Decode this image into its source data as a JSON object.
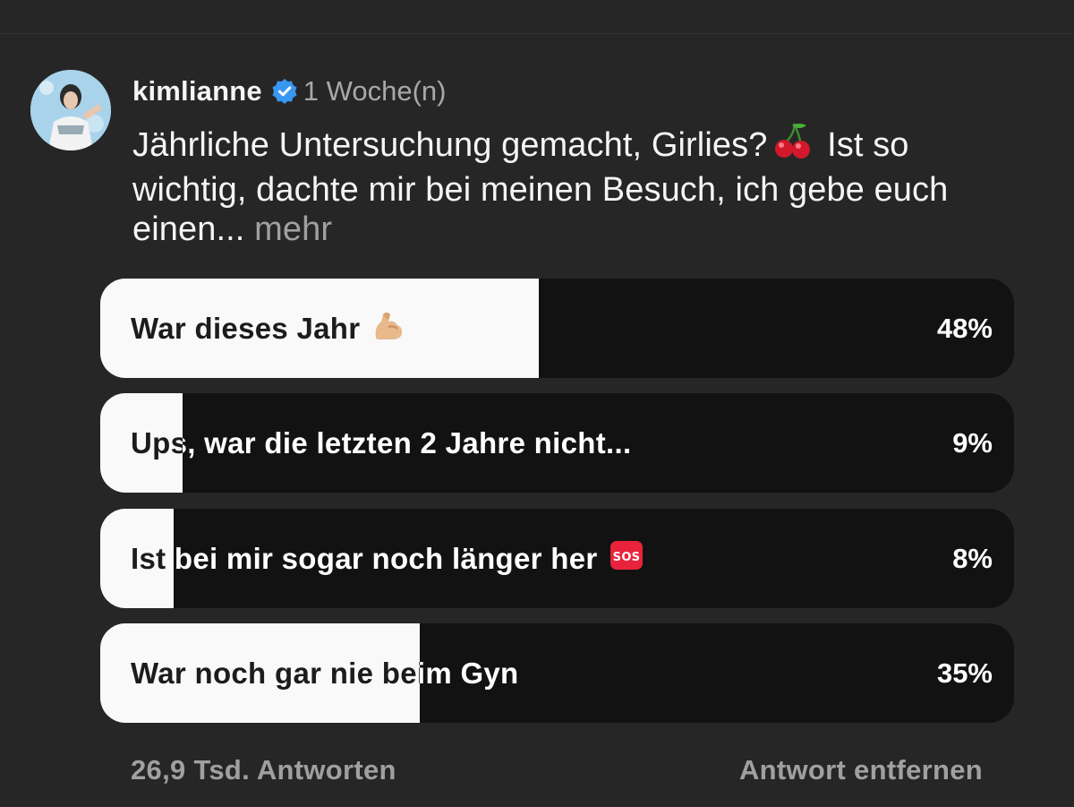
{
  "post": {
    "username": "kimlianne",
    "verified_icon": "verified-badge-icon",
    "timestamp": "1 Woche(n)",
    "caption_line1": "Jährliche Untersuchung gemacht, Girlies?",
    "caption_emoji": "cherries-emoji",
    "caption_line1_rest": "Ist so",
    "caption_line2": "wichtig, dachte mir bei meinen Besuch, ich gebe euch",
    "caption_line3": "einen...",
    "more_label": "mehr"
  },
  "poll": {
    "options": [
      {
        "label": "War dieses Jahr",
        "emoji": "flexed-biceps-emoji",
        "percent_text": "48%",
        "percent": 48
      },
      {
        "label": "Ups, war die letzten 2 Jahre nicht...",
        "emoji": "",
        "percent_text": "9%",
        "percent": 9
      },
      {
        "label": "Ist bei mir sogar noch länger her",
        "emoji": "sos-emoji",
        "percent_text": "8%",
        "percent": 8
      },
      {
        "label": "War noch gar nie beim Gyn",
        "emoji": "",
        "percent_text": "35%",
        "percent": 35
      }
    ],
    "colors": {
      "fill": "#f9f9f9",
      "track": "#121212"
    }
  },
  "footer": {
    "responses": "26,9 Tsd. Antworten",
    "remove_vote": "Antwort entfernen"
  }
}
